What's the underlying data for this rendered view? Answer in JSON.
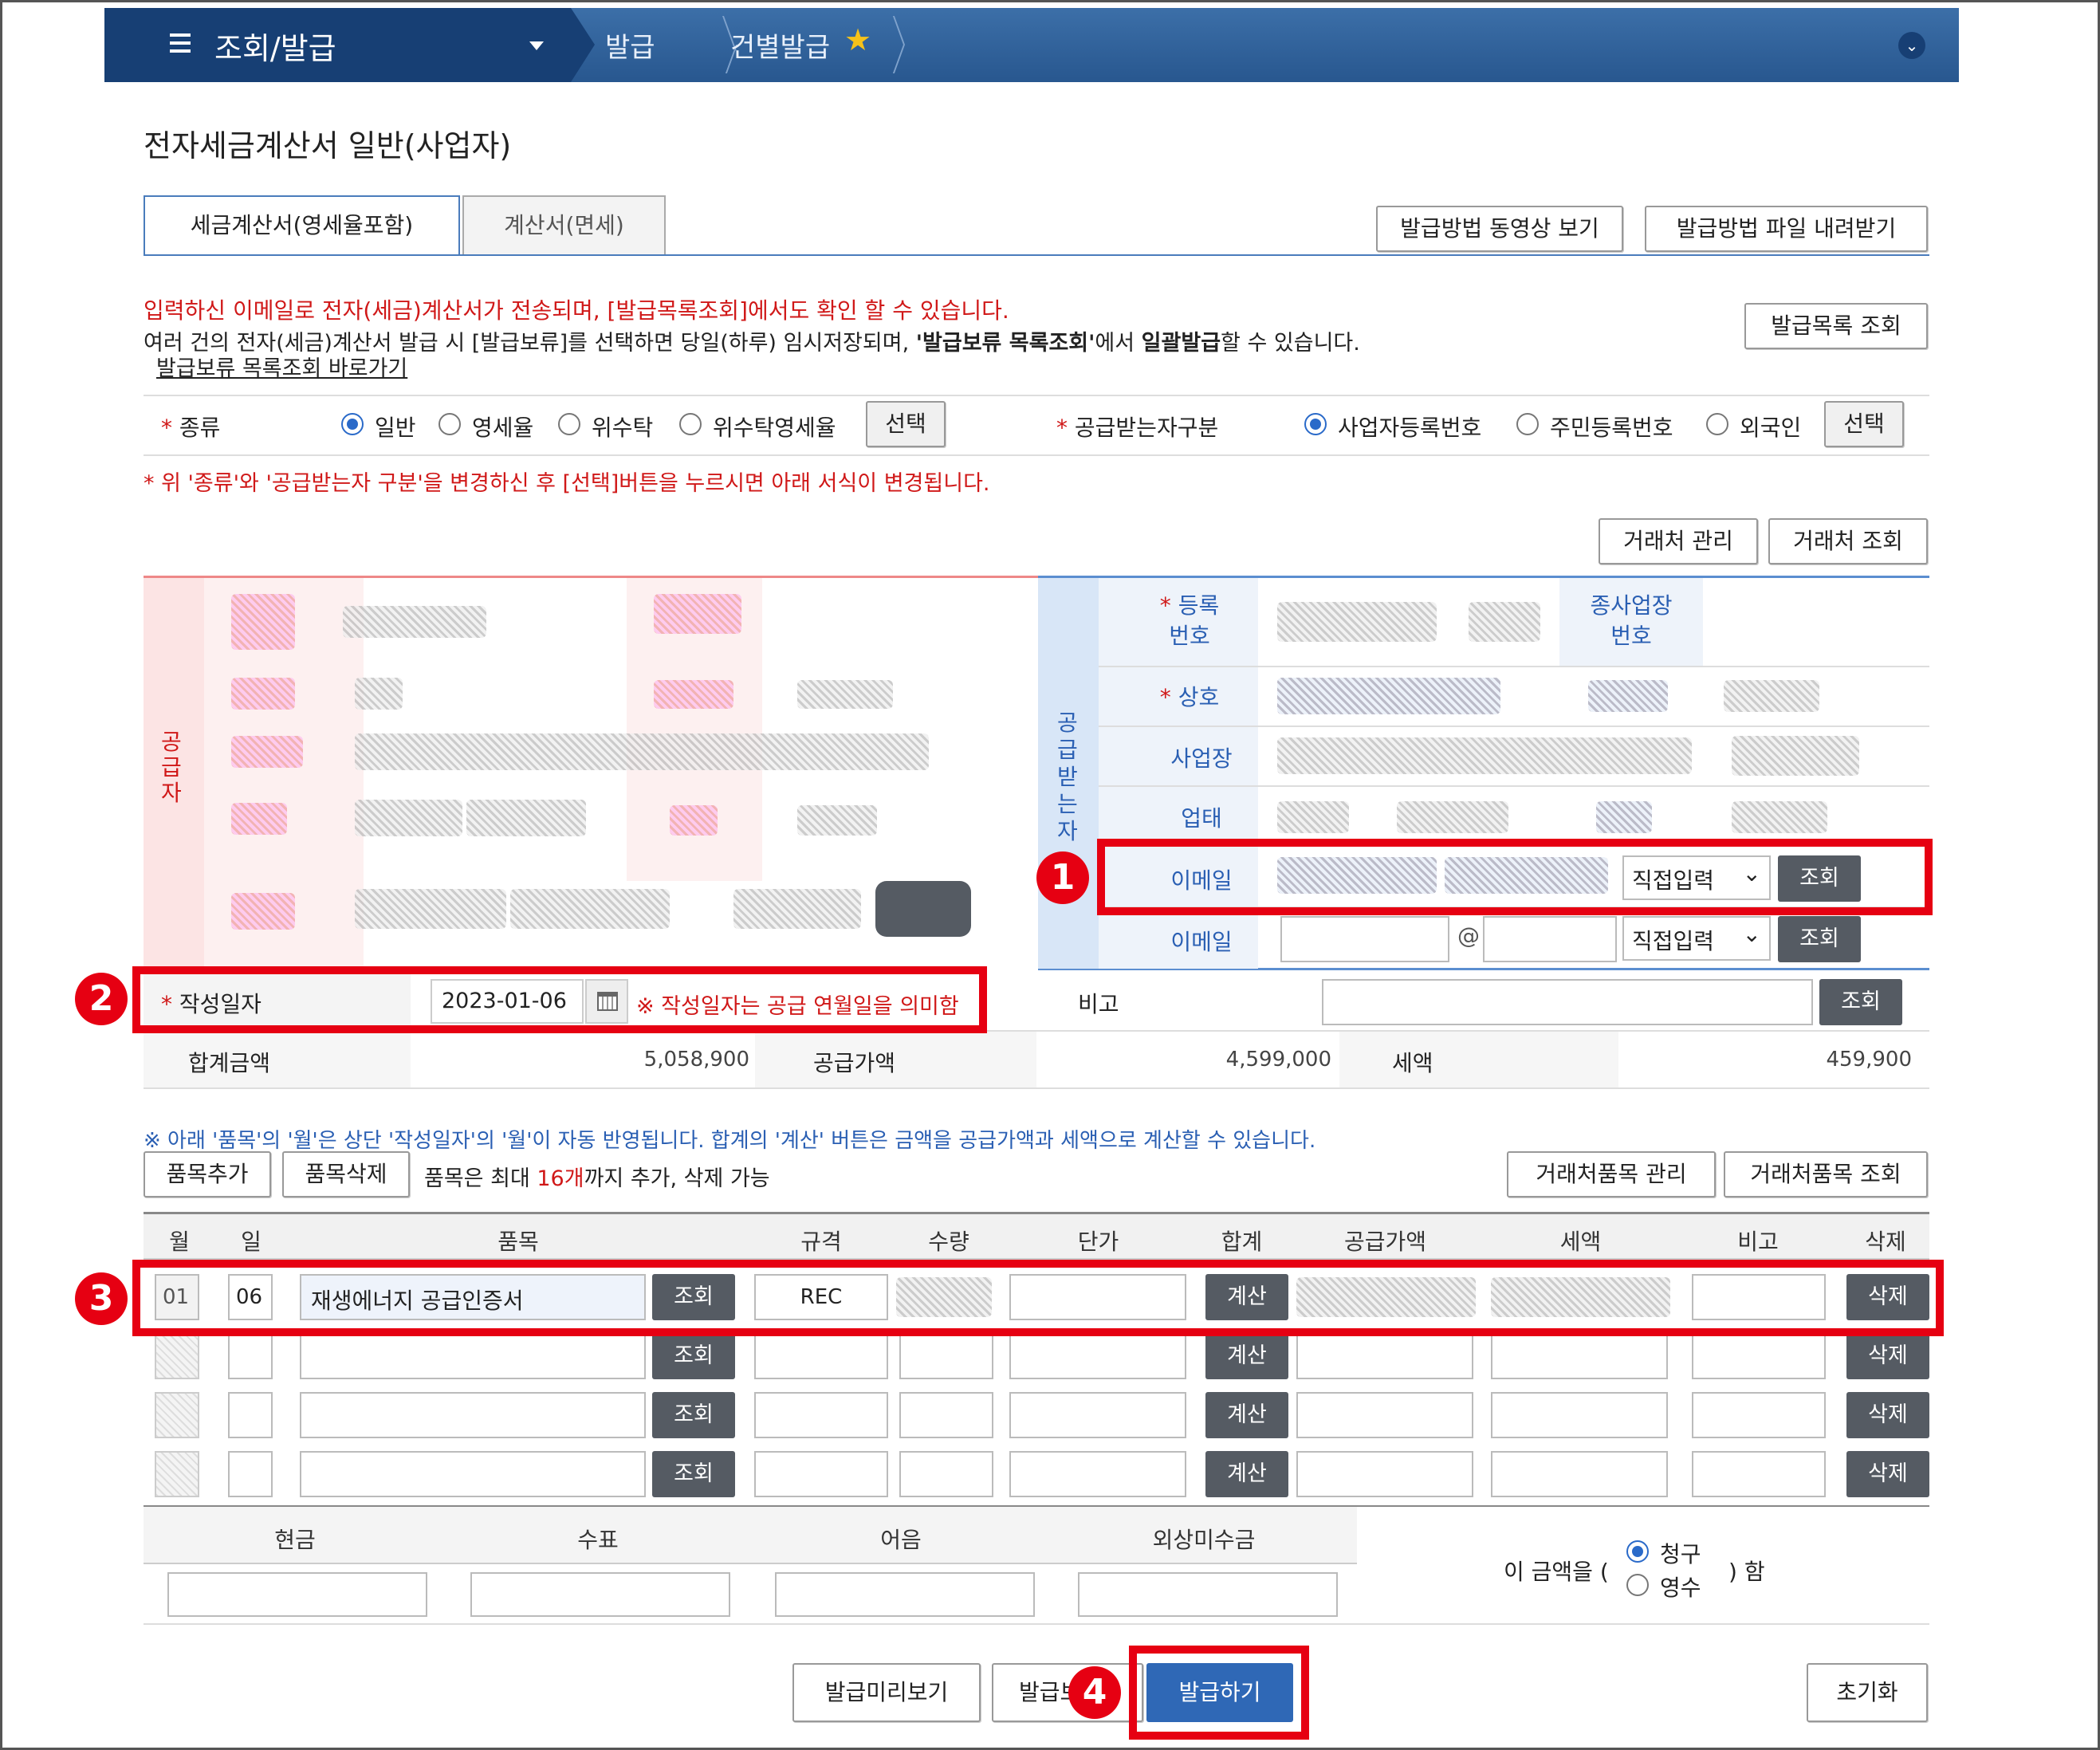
{
  "nav": {
    "menu_label": "조회/발급",
    "crumb1": "발급",
    "crumb2": "건별발급"
  },
  "page_title": "전자세금계산서 일반(사업자)",
  "tabs": [
    "세금계산서(영세율포함)",
    "계산서(면세)"
  ],
  "top_buttons": {
    "video": "발급방법 동영상 보기",
    "file": "발급방법 파일 내려받기",
    "list": "발급목록 조회"
  },
  "notice": {
    "line1": "입력하신 이메일로 전자(세금)계산서가 전송되며, [발급목록조회]에서도 확인 할 수 있습니다.",
    "line2_a": "여러 건의 전자(세금)계산서 발급 시 [발급보류]를 선택하면 당일(하루) 임시저장되며, ",
    "line2_b": "'발급보류 목록조회'",
    "line2_c": "에서 ",
    "line2_d": "일괄발급",
    "line2_e": "할 수 있습니다.",
    "link": "발급보류 목록조회 바로가기"
  },
  "kind": {
    "label": "종류",
    "options": [
      "일반",
      "영세율",
      "위수탁",
      "위수탁영세율"
    ],
    "select": "선택"
  },
  "recv_type": {
    "label": "공급받는자구분",
    "options": [
      "사업자등록번호",
      "주민등록번호",
      "외국인"
    ],
    "select": "선택"
  },
  "change_notice": "* 위 '종류'와 '공급받는자 구분'을 변경하신 후 [선택]버튼을 누르시면 아래 서식이 변경됩니다.",
  "partner_buttons": {
    "manage": "거래처 관리",
    "search": "거래처 조회"
  },
  "supplier": {
    "side_label": "공급자"
  },
  "receiver": {
    "side_label": "공급받는자",
    "reg_no": "등록\n번호",
    "sub_no": "종사업장\n번호",
    "name": "상호",
    "place": "사업장",
    "biz": "업태",
    "email1": "이메일",
    "email2": "이메일",
    "direct": "직접입력",
    "at": "@",
    "search": "조회"
  },
  "write_date": {
    "label": "작성일자",
    "value": "2023-01-06",
    "note": "※ 작성일자는 공급 연월일을 의미함"
  },
  "remark": {
    "label": "비고",
    "search": "조회"
  },
  "totals": {
    "total_label": "합계금액",
    "total": "5,058,900",
    "supply_label": "공급가액",
    "supply": "4,599,000",
    "tax_label": "세액",
    "tax": "459,900"
  },
  "items_notice": "※ 아래 '품목'의 '월'은 상단 '작성일자'의 '월'이 자동 반영됩니다. 합계의 '계산' 버튼은 금액을 공급가액과 세액으로 계산할 수 있습니다.",
  "items_controls": {
    "add": "품목추가",
    "del": "품목삭제",
    "max_a": "품목은 최대 ",
    "max_b": "16개",
    "max_c": "까지 추가, 삭제 가능",
    "manage": "거래처품목 관리",
    "search": "거래처품목 조회"
  },
  "item_headers": [
    "월",
    "일",
    "품목",
    "규격",
    "수량",
    "단가",
    "합계",
    "공급가액",
    "세액",
    "비고",
    "삭제"
  ],
  "item_row1": {
    "month": "01",
    "day": "06",
    "name": "재생에너지 공급인증서",
    "spec": "REC"
  },
  "row_buttons": {
    "search": "조회",
    "calc": "계산",
    "delete": "삭제"
  },
  "payment": {
    "headers": [
      "현금",
      "수표",
      "어음",
      "외상미수금"
    ],
    "amount_a": "이 금액을 (",
    "amount_b": ") 함",
    "claim": "청구",
    "receipt": "영수"
  },
  "bottom": {
    "preview": "발급미리보기",
    "hold": "발급보류",
    "issue": "발급하기",
    "reset": "초기화"
  },
  "markers": [
    "1",
    "2",
    "3",
    "4"
  ]
}
